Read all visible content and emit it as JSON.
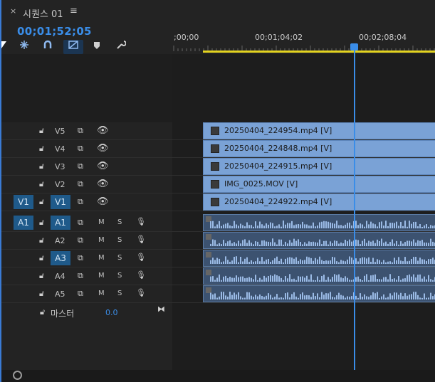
{
  "panel": {
    "close_icon": "×",
    "title": "시퀀스 01",
    "menu_icon": "≡",
    "timecode": "00;01;52;05"
  },
  "toolbar": {
    "snap_icon": "snap-icon",
    "magnet_icon": "linked-selection-icon",
    "marker_icon": "marker-icon",
    "wrench_icon": "wrench-icon"
  },
  "ruler": {
    "labels": [
      ";00;00",
      "00;01;04;02",
      "00;02;08;04"
    ]
  },
  "video_tracks": [
    {
      "name": "V5",
      "clip": "20250404_224954.mp4 [V]"
    },
    {
      "name": "V4",
      "clip": "20250404_224848.mp4 [V]"
    },
    {
      "name": "V3",
      "clip": "20250404_224915.mp4 [V]"
    },
    {
      "name": "V2",
      "clip": "IMG_0025.MOV [V]"
    },
    {
      "name": "V1",
      "clip": "20250404_224922.mp4 [V]",
      "source": "V1"
    }
  ],
  "audio_tracks": [
    {
      "name": "A1",
      "source": "A1"
    },
    {
      "name": "A2"
    },
    {
      "name": "A3"
    },
    {
      "name": "A4"
    },
    {
      "name": "A5"
    }
  ],
  "track_buttons": {
    "mute": "M",
    "solo": "S"
  },
  "master": {
    "label": "마스터",
    "value": "0.0"
  },
  "colors": {
    "accent": "#3a8de8",
    "video_clip": "#7aa2d6",
    "audio_clip": "#3c5270",
    "work_area": "#e3d320"
  }
}
